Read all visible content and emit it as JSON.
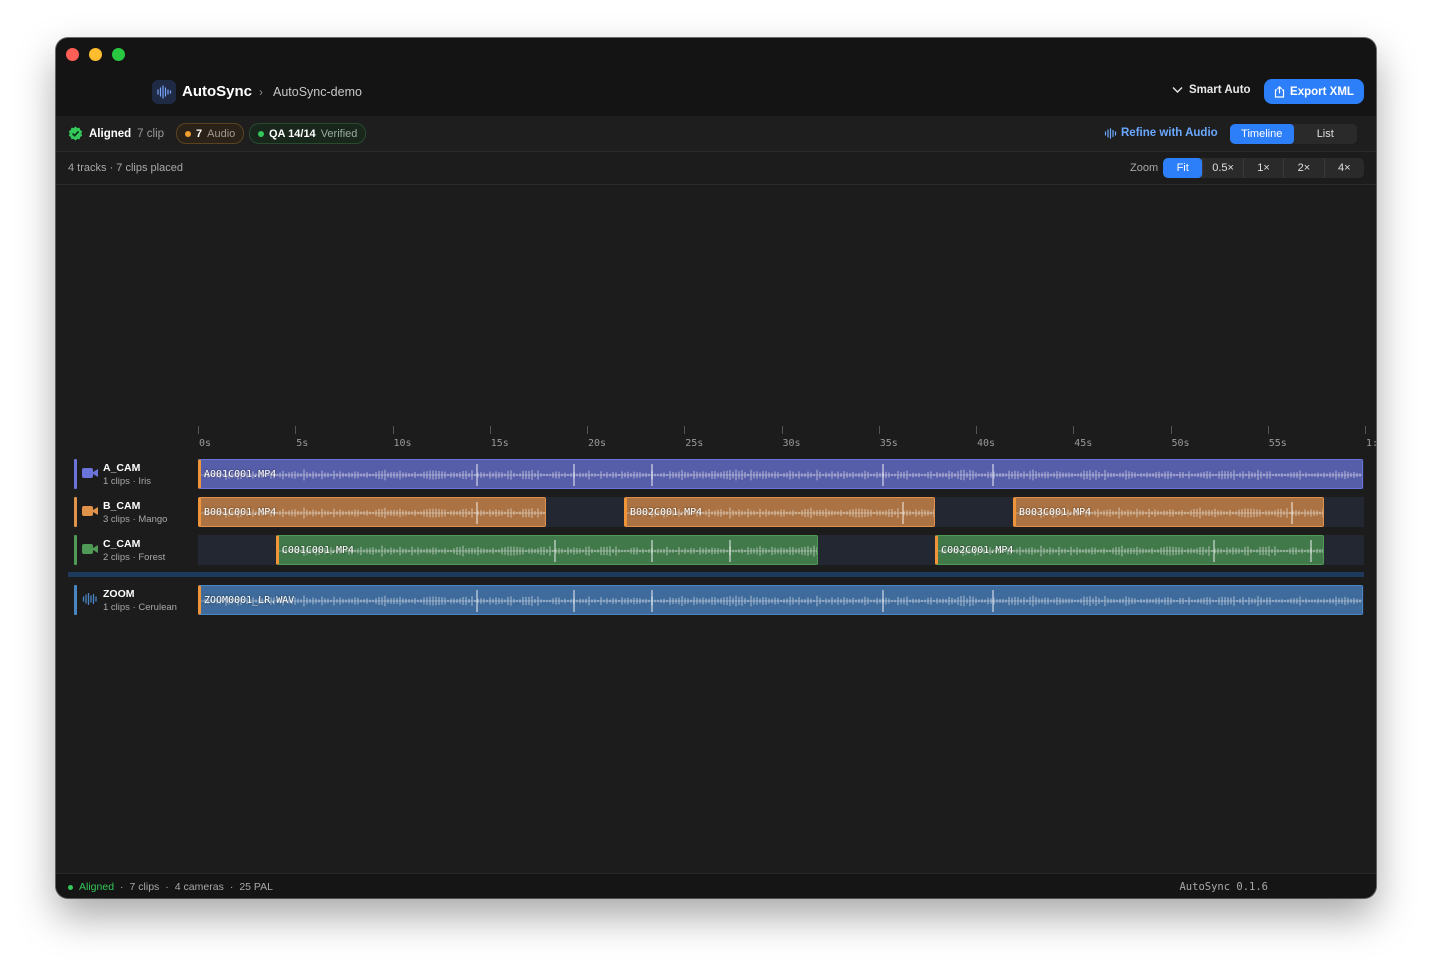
{
  "header": {
    "app_title": "AutoSync",
    "project_name": "AutoSync-demo",
    "smart_auto_label": "Smart Auto",
    "export_label": "Export XML"
  },
  "status": {
    "aligned_label": "Aligned",
    "aligned_sub": "7 clip",
    "audio_count": "7",
    "audio_label": "Audio",
    "qa_value": "QA 14/14",
    "qa_label": "Verified",
    "refine_label": "Refine with Audio",
    "view_tabs": [
      "Timeline",
      "List"
    ],
    "active_view": "Timeline"
  },
  "info": {
    "summary": "4 tracks · 7 clips placed",
    "zoom_label": "Zoom",
    "zoom_options": [
      "Fit",
      "0.5×",
      "1×",
      "2×",
      "4×"
    ],
    "active_zoom": "Fit"
  },
  "ruler": {
    "labels": [
      "0s",
      "5s",
      "10s",
      "15s",
      "20s",
      "25s",
      "30s",
      "35s",
      "40s",
      "45s",
      "50s",
      "55s",
      "1:"
    ]
  },
  "tracks": [
    {
      "name": "A_CAM",
      "sub": "1 clips · Iris",
      "kind": "camera",
      "color": "#6b74d8",
      "clips": [
        {
          "label": "A001C001.MP4",
          "start": 0,
          "end": 59.9
        }
      ]
    },
    {
      "name": "B_CAM",
      "sub": "3 clips · Mango",
      "kind": "camera",
      "color": "#e0924a",
      "clips": [
        {
          "label": "B001C001.MP4",
          "start": 0,
          "end": 17.9
        },
        {
          "label": "B002C001.MP4",
          "start": 21.9,
          "end": 37.9
        },
        {
          "label": "B003C001.MP4",
          "start": 41.9,
          "end": 57.9
        }
      ]
    },
    {
      "name": "C_CAM",
      "sub": "2 clips · Forest",
      "kind": "camera",
      "color": "#4f9a54",
      "clips": [
        {
          "label": "C001C001.MP4",
          "start": 4,
          "end": 31.9
        },
        {
          "label": "C002C001.MP4",
          "start": 37.9,
          "end": 57.9
        }
      ]
    },
    {
      "name": "ZOOM",
      "sub": "1 clips · Cerulean",
      "kind": "audio",
      "color": "#4a86c4",
      "clips": [
        {
          "label": "ZOOM0001_LR.WAV",
          "start": 0,
          "end": 59.9
        }
      ]
    }
  ],
  "timeline": {
    "duration_s": 60
  },
  "colors": {
    "accent": "#2d7ff9",
    "success": "#34c759",
    "warning": "#f0a030",
    "clip_edge": "#f0943a"
  },
  "icons": {
    "app": "waveform-icon",
    "smart_auto": "chevron-down-icon",
    "export": "share-icon",
    "aligned": "check-badge-icon",
    "refine": "waveform-icon",
    "camera": "video-camera-icon",
    "audio": "waveform-icon"
  },
  "footer": {
    "aligned_label": "Aligned",
    "items": [
      "7 clips",
      "4 cameras",
      "25 PAL"
    ],
    "version": "AutoSync 0.1.6"
  }
}
